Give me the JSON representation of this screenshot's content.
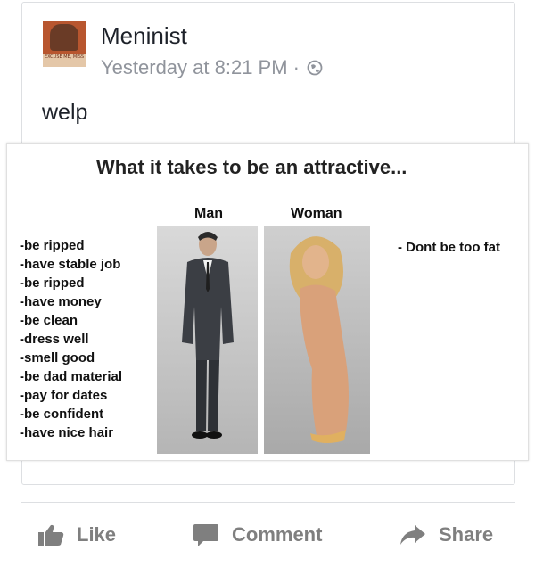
{
  "post": {
    "author": "Meninist",
    "timestamp": "Yesterday at 8:21 PM",
    "separator": "·",
    "privacy_icon": "globe-icon",
    "avatar_caption": "EXCUSE ME, MISS",
    "status_text": "welp"
  },
  "meme": {
    "title": "What it takes to be an attractive...",
    "man_label": "Man",
    "woman_label": "Woman",
    "man_requirements": [
      "-be ripped",
      "-have stable job",
      "-be ripped",
      "-have money",
      "-be clean",
      "-dress well",
      "-smell good",
      "-be dad material",
      "-pay for dates",
      "-be confident",
      "-have nice hair"
    ],
    "woman_requirement": "- Dont be too fat"
  },
  "actions": {
    "like": "Like",
    "comment": "Comment",
    "share": "Share"
  },
  "colors": {
    "text_primary": "#1d2129",
    "text_secondary": "#90949c",
    "action_gray": "#7f7f7f",
    "border": "#dddfe2"
  }
}
